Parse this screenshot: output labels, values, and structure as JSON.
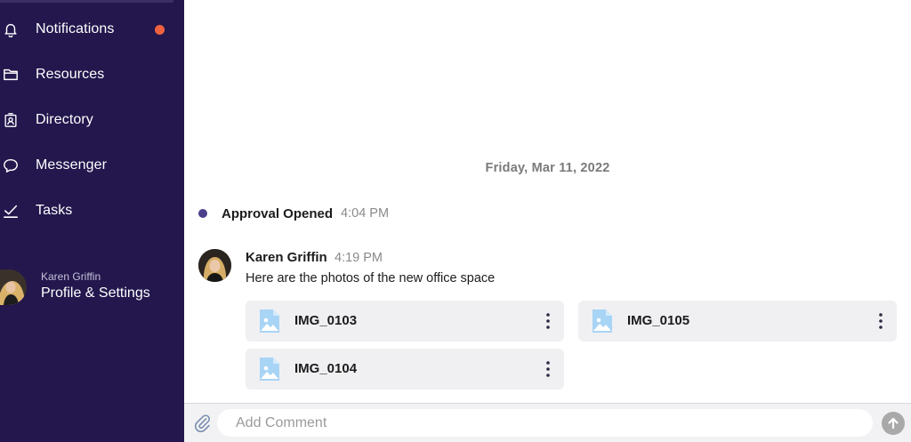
{
  "sidebar": {
    "items": [
      {
        "label": "Notifications",
        "icon": "bell-icon",
        "has_badge": true
      },
      {
        "label": "Resources",
        "icon": "folder-icon"
      },
      {
        "label": "Directory",
        "icon": "directory-icon"
      },
      {
        "label": "Messenger",
        "icon": "chat-bubble-icon"
      },
      {
        "label": "Tasks",
        "icon": "checkmark-icon"
      }
    ],
    "profile": {
      "name": "Karen Griffin",
      "link_label": "Profile & Settings"
    }
  },
  "feed": {
    "date_divider": "Friday, Mar 11, 2022",
    "event": {
      "title": "Approval Opened",
      "time": "4:04 PM"
    },
    "message": {
      "author": "Karen Griffin",
      "time": "4:19 PM",
      "text": "Here are the photos of the new office space",
      "attachments": [
        {
          "name": "IMG_0103"
        },
        {
          "name": "IMG_0105"
        },
        {
          "name": "IMG_0104"
        }
      ]
    }
  },
  "composer": {
    "placeholder": "Add Comment"
  },
  "colors": {
    "sidebar_bg": "#23174d",
    "badge": "#f0623f",
    "event_dot": "#4b3f8c",
    "attachment_bg": "#f0f0f2",
    "image_icon": "#a8d4f5"
  }
}
